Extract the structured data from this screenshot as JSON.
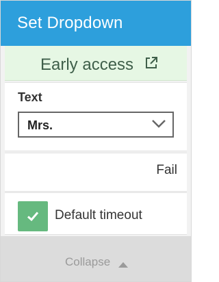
{
  "header": {
    "title": "Set Dropdown"
  },
  "banner": {
    "label": "Early access",
    "icon": "external-link-icon"
  },
  "text_field": {
    "label": "Text",
    "selected_value": "Mrs.",
    "icon": "chevron-down-icon"
  },
  "status": {
    "text": "Fail"
  },
  "option": {
    "label": "Default timeout",
    "checked": true,
    "icon": "checkmark-icon"
  },
  "footer": {
    "collapse_label": "Collapse",
    "icon": "caret-up-icon"
  },
  "colors": {
    "header": "#2d9fdc",
    "banner": "#e6f7e4",
    "checkbox": "#66b97f",
    "footer": "#dcdcdc"
  }
}
